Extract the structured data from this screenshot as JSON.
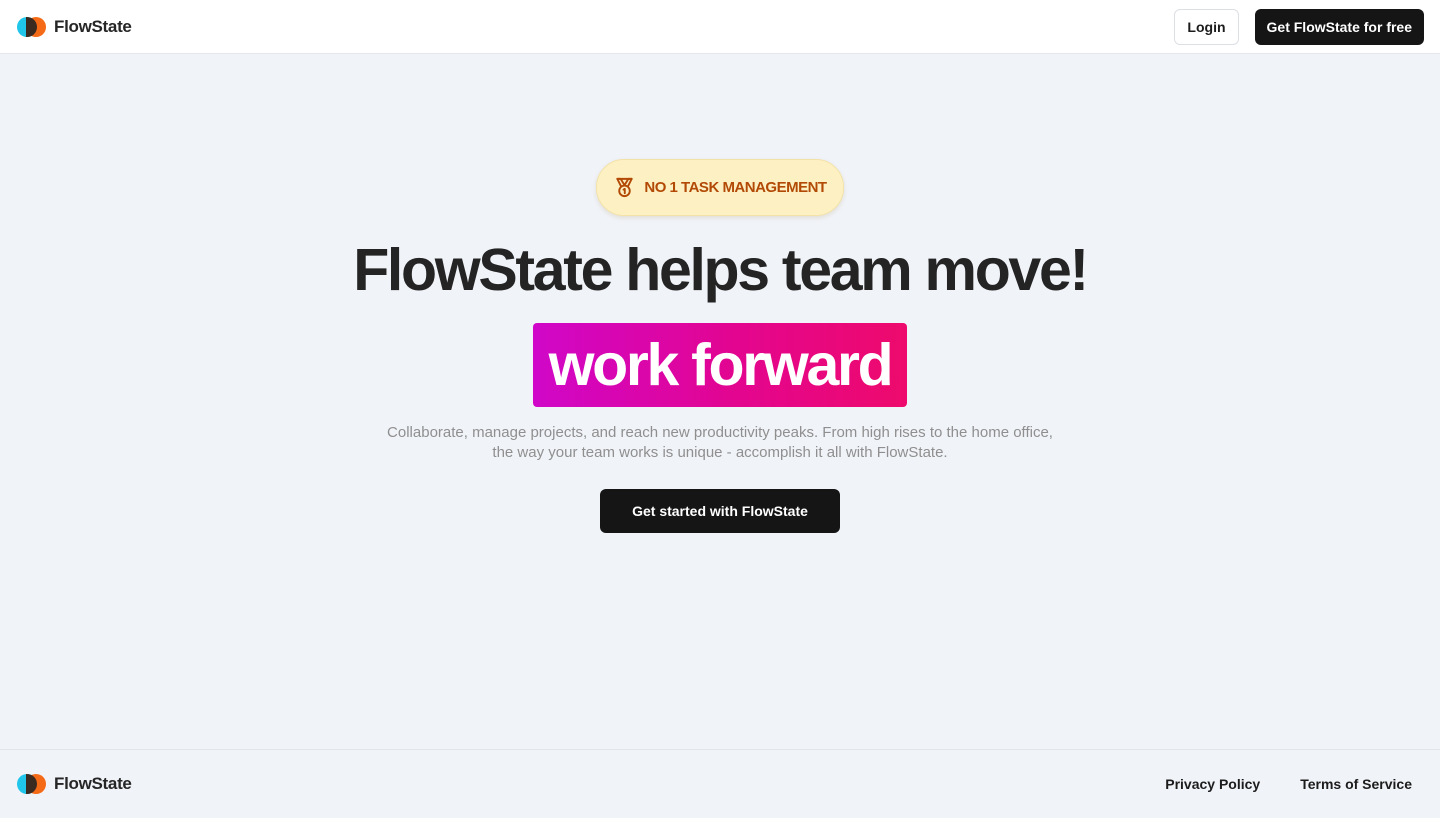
{
  "header": {
    "brand_name": "FlowState",
    "login_label": "Login",
    "cta_label": "Get FlowState for free"
  },
  "hero": {
    "badge_text": "NO 1 TASK MANAGEMENT",
    "badge_icon": "medal-icon",
    "headline": "FlowState helps team move!",
    "highlight": "work forward",
    "subtext": "Collaborate, manage projects, and reach new productivity peaks. From high rises to the home office, the way your team works is unique - accomplish it all with FlowState.",
    "cta_label": "Get started with FlowState"
  },
  "footer": {
    "brand_name": "FlowState",
    "links": [
      "Privacy Policy",
      "Terms of Service"
    ]
  },
  "colors": {
    "logo_left": "#20c6ea",
    "logo_right": "#f56a17",
    "badge_bg": "#fdf1c4",
    "badge_text": "#b24a06",
    "highlight_start": "#d007c9",
    "highlight_end": "#ee0a6c",
    "dark_button": "#151515",
    "page_bg": "#f0f3f8"
  }
}
